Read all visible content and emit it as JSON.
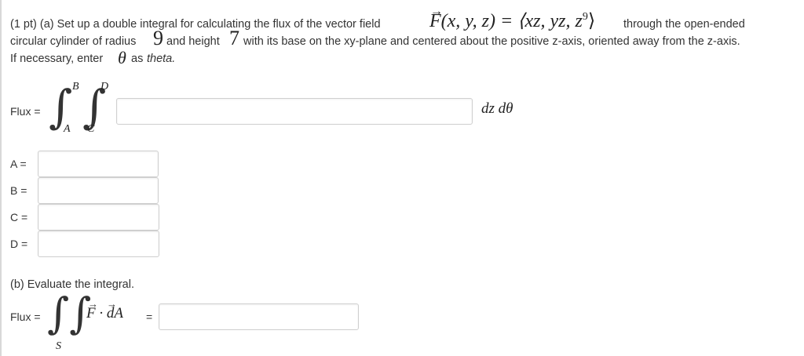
{
  "problem": {
    "part_a_prefix": "(1 pt) (a) Set up a double integral for calculating the flux of the vector field",
    "field_lhs": "F(x, y, z) = ⟨xz, yz, z",
    "field_exp": "9",
    "field_rbr": "⟩",
    "line1_tail": "through the open-ended",
    "line2_a": "circular cylinder of radius",
    "radius": "9",
    "line2_b": "and height",
    "height": "7",
    "line2_c": "with its base on the xy-plane and centered about the positive z-axis, oriented away from the z-axis.",
    "line3_a": "If necessary, enter",
    "theta_symbol": "θ",
    "line3_b": "as",
    "line3_c": "theta."
  },
  "integral_a": {
    "flux_label": "Flux =",
    "upper_outer": "B",
    "upper_inner": "D",
    "lower_outer": "A",
    "lower_inner": "C",
    "differentials": "dz dθ",
    "integrand_value": ""
  },
  "limits": [
    {
      "label": "A =",
      "value": ""
    },
    {
      "label": "B =",
      "value": ""
    },
    {
      "label": "C =",
      "value": ""
    },
    {
      "label": "D =",
      "value": ""
    }
  ],
  "part_b": {
    "heading": "(b) Evaluate the integral.",
    "flux_label": "Flux =",
    "surface": "S",
    "integrand": "F · dA",
    "equals": "=",
    "answer_value": ""
  }
}
